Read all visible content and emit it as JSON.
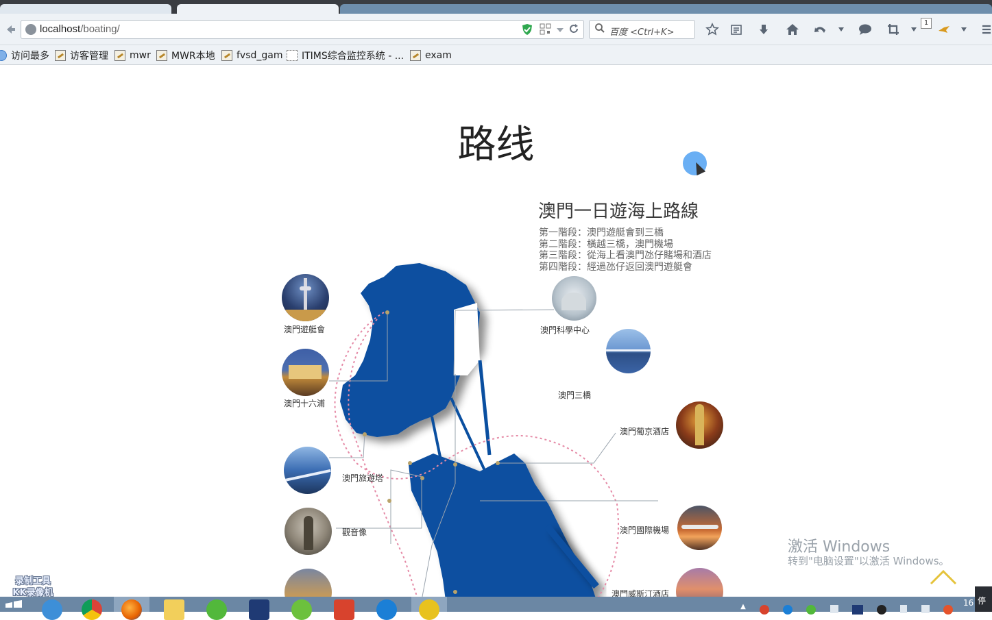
{
  "browser": {
    "url_host": "localhost",
    "url_path": "/boating/",
    "search_placeholder": "百度 <Ctrl+K>",
    "notification_count": "1"
  },
  "bookmarks": [
    {
      "label": "访问最多",
      "icon": "globe-icon"
    },
    {
      "label": "访客管理",
      "icon": "broken-image-icon"
    },
    {
      "label": "mwr",
      "icon": "broken-image-icon"
    },
    {
      "label": "MWR本地",
      "icon": "broken-image-icon"
    },
    {
      "label": "fvsd_gam",
      "icon": "broken-image-icon"
    },
    {
      "label": "ITIMS综合监控系统 - ...",
      "icon": "blank-page-icon"
    },
    {
      "label": "exam",
      "icon": "broken-image-icon"
    }
  ],
  "page": {
    "heading": "路线",
    "route_title": "澳門一日遊海上路線",
    "stages": [
      "第一階段：澳門遊艇會到三橋",
      "第二階段：橫越三橋，澳門機場",
      "第三階段：從海上看澳門氹仔賭場和酒店",
      "第四階段：經過氹仔返回澳門遊艇會"
    ],
    "map_points": [
      {
        "label": "澳門遊艇會"
      },
      {
        "label": "澳門十六浦"
      },
      {
        "label": "澳門旅遊塔"
      },
      {
        "label": "觀音像"
      },
      {
        "label": "澳門科學中心"
      },
      {
        "label": "澳門三橋"
      },
      {
        "label": "澳門葡京酒店"
      },
      {
        "label": "澳門國際機場"
      },
      {
        "label": "澳門威斯汀酒店"
      }
    ]
  },
  "overlay": {
    "activate_title": "激活 Windows",
    "activate_sub": "转到\"电脑设置\"以激活 Windows。",
    "watermark_line1": "录制工具",
    "watermark_line2": "KK录像机"
  },
  "taskbar": {
    "clock": "16",
    "stop_label": "停"
  },
  "colors": {
    "map_blue": "#0a4fa0",
    "route_dots": "#e58aa6",
    "browser_chrome": "#eef2f6"
  }
}
